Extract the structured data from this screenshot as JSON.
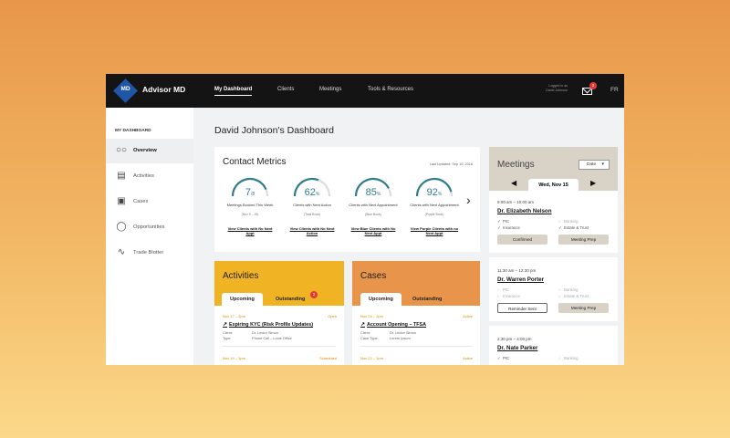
{
  "app": {
    "logo": "MD",
    "name": "Advisor MD"
  },
  "nav": [
    "My Dashboard",
    "Clients",
    "Meetings",
    "Tools & Resources"
  ],
  "user": {
    "logged_in_as": "Logged in as",
    "name": "David Johnson"
  },
  "notifications": {
    "count": "2"
  },
  "lang": "FR",
  "sidebar": {
    "title": "MY DASHBOARD",
    "items": [
      {
        "label": "Overview",
        "icon": "binoculars-icon"
      },
      {
        "label": "Activities",
        "icon": "clipboard-icon"
      },
      {
        "label": "Cases",
        "icon": "briefcase-icon"
      },
      {
        "label": "Opportunities",
        "icon": "lightbulb-icon"
      },
      {
        "label": "Trade Blotter",
        "icon": "chart-nodes-icon"
      }
    ]
  },
  "page_title": "David Johnson's Dashboard",
  "metrics": {
    "title": "Contact Metrics",
    "updated": "Last Updated: Sep 15, 2018",
    "gauges": [
      {
        "value": "7",
        "unit": "/8",
        "pct": 0.875,
        "caption": "Meetings Booked This Week",
        "sub": "(Nov 9 – 15)",
        "link": "View Clients with No Next Appt"
      },
      {
        "value": "62",
        "unit": "%",
        "pct": 0.62,
        "caption": "Clients with Next Action",
        "sub": "(Total Book)",
        "link": "View Clients with No Next Action"
      },
      {
        "value": "85",
        "unit": "%",
        "pct": 0.85,
        "caption": "Clients with Next Appointment",
        "sub": "(Blue Book)",
        "link": "View Blue Clients with No Next Appt"
      },
      {
        "value": "92",
        "unit": "%",
        "pct": 0.92,
        "caption": "Clients with Next Appointment",
        "sub": "(Purple Book)",
        "link": "View Purple Clients with no Next Appt"
      }
    ]
  },
  "activities": {
    "title": "Activities",
    "tabs": [
      "Upcoming",
      "Outstanding"
    ],
    "badge": "2",
    "items": [
      {
        "date": "Nov 17 – 2pm",
        "status": "Open",
        "title": "Expiring KYC (Risk Profile Updates)",
        "client_label": "Client:",
        "client": "Dr. Lector Simon",
        "type_label": "Type:",
        "type": "Phone Call – Louis Office"
      },
      {
        "date": "Nov 19 – 1pm",
        "status": "Scheduled"
      }
    ]
  },
  "cases": {
    "title": "Cases",
    "tabs": [
      "Upcoming",
      "Outstanding"
    ],
    "items": [
      {
        "date": "Nov 24 – 2pm",
        "status": "Active",
        "title": "Account Opening – TFSA",
        "client_label": "Client:",
        "client": "Dr. Lector Simon",
        "type_label": "Case Type:",
        "type": "Lorem Ipsum"
      },
      {
        "date": "Nov 22 – 1pm",
        "status": "Active"
      }
    ]
  },
  "meetings": {
    "title": "Meetings",
    "date_button": "Date",
    "day": "Wed, Nov 15",
    "items": [
      {
        "time": "9:00 am – 10:00 am",
        "name": "Dr. Elizabeth Nelson",
        "checks": [
          {
            "label": "PIC",
            "on": true
          },
          {
            "label": "Banking",
            "on": false
          },
          {
            "label": "Insurance",
            "on": true
          },
          {
            "label": "Estate & Trust",
            "on": true
          }
        ],
        "buttons": [
          "Confirmed",
          "Meeting Prep"
        ]
      },
      {
        "time": "11:30 am – 12:30 pm",
        "name": "Dr. Warren Porter",
        "checks": [
          {
            "label": "PIC",
            "on": false
          },
          {
            "label": "Banking",
            "on": false
          },
          {
            "label": "Insurance",
            "on": false
          },
          {
            "label": "Estate & Trust",
            "on": false
          }
        ],
        "buttons": [
          "Reminder Sent",
          "Meeting Prep"
        ]
      },
      {
        "time": "2:30 pm – 4:00 pm",
        "name": "Dr. Nate Parker",
        "checks": [
          {
            "label": "PIC",
            "on": true
          },
          {
            "label": "Banking",
            "on": false
          }
        ]
      }
    ]
  },
  "colors": {
    "teal": "#2f7d8c",
    "activities": "#f0b324",
    "cases": "#e8954b",
    "meetings": "#d8d2c7"
  }
}
